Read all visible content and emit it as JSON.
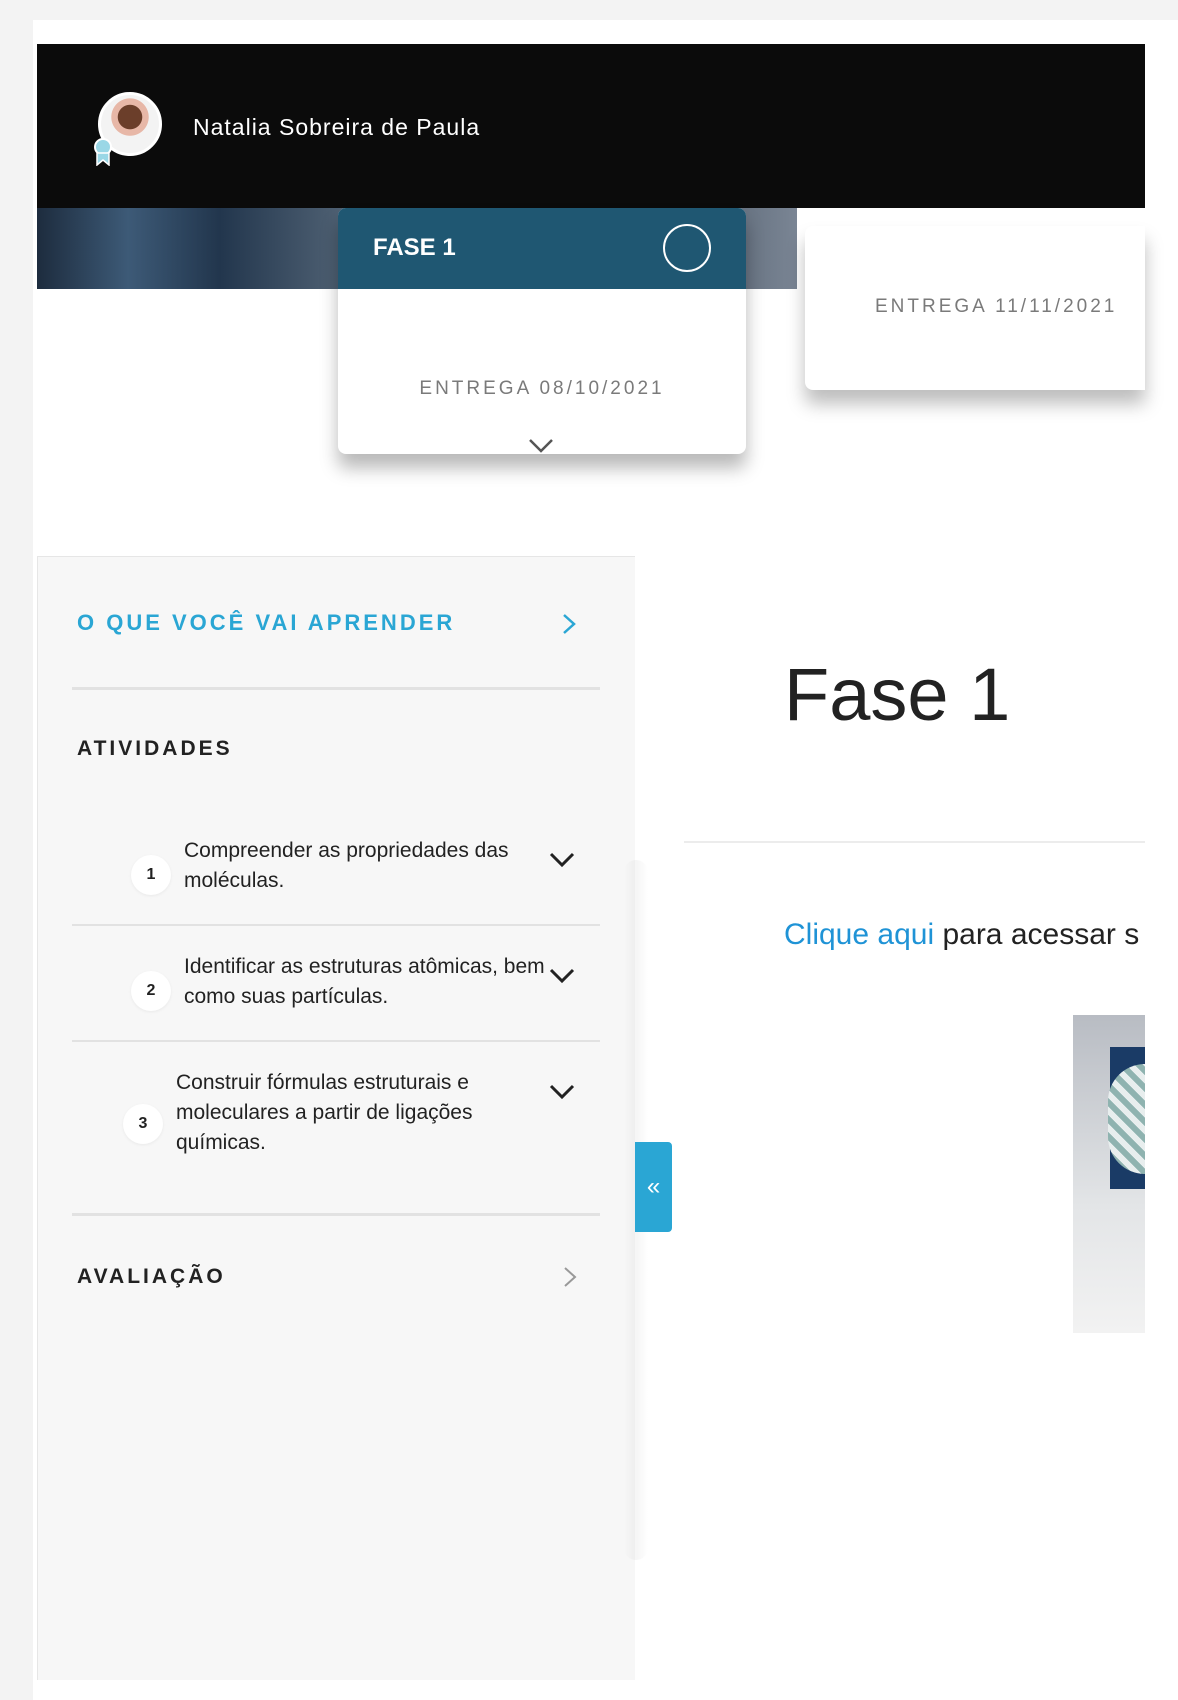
{
  "header": {
    "user_name": "Natalia Sobreira de Paula"
  },
  "phases": [
    {
      "title": "FASE 1",
      "delivery": "ENTREGA 08/10/2021"
    },
    {
      "delivery": "ENTREGA 11/11/2021"
    }
  ],
  "sidebar": {
    "learn_link": "O QUE VOCÊ VAI APRENDER",
    "activities_label": "ATIVIDADES",
    "activities": [
      {
        "num": "1",
        "text": "Compreender as propriedades das moléculas."
      },
      {
        "num": "2",
        "text": "Identificar as estruturas atômicas, bem como suas partículas."
      },
      {
        "num": "3",
        "text": "Construir fórmulas estruturais e moleculares a partir de ligações químicas."
      }
    ],
    "assessment_label": "AVALIAÇÃO",
    "collapse_label": "«"
  },
  "main": {
    "title": "Fase 1",
    "link_text": "Clique aqui",
    "link_suffix": " para acessar s"
  },
  "colors": {
    "accent": "#2aa6d4",
    "phase_header": "#1f5772",
    "topbar": "#0b0b0b"
  }
}
